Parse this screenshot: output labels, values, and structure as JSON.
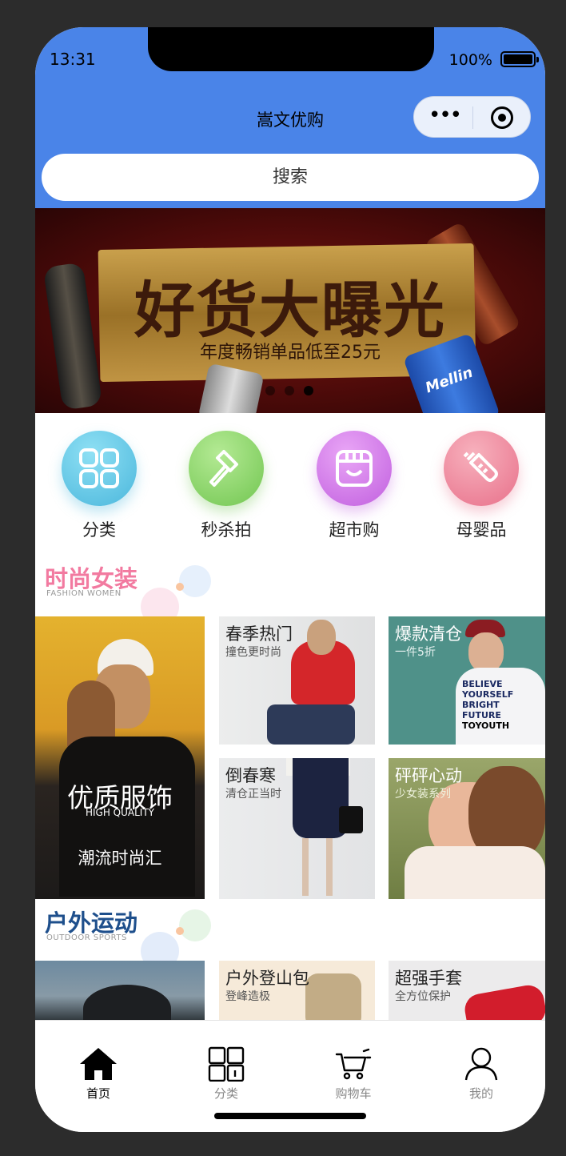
{
  "status_bar": {
    "time": "13:31",
    "battery": "100%"
  },
  "navbar": {
    "title": "嵩文优购",
    "more_icon": "more-dots-icon",
    "close_icon": "target-icon"
  },
  "search": {
    "placeholder": "搜索"
  },
  "banner": {
    "title": "好货大曝光",
    "subtitle": "年度畅销单品低至25元",
    "slide_count": 3,
    "active_slide": 3,
    "bottle_label": "Mellin"
  },
  "categories": [
    {
      "label": "分类",
      "icon": "grid-icon",
      "color": "#5fc3e6"
    },
    {
      "label": "秒杀拍",
      "icon": "hammer-icon",
      "color": "#8fd46e"
    },
    {
      "label": "超市购",
      "icon": "shop-icon",
      "color": "#d37ee8"
    },
    {
      "label": "母婴品",
      "icon": "baby-bottle-icon",
      "color": "#f0889a"
    }
  ],
  "sections": [
    {
      "title": "时尚女装",
      "subtitle": "FASHION WOMEN",
      "title_color": "#f27aa0",
      "tiles": [
        {
          "title": "优质服饰",
          "subtitle": "HIGH QUALITY",
          "slogan": "潮流时尚汇"
        },
        {
          "title": "春季热门",
          "subtitle": "撞色更时尚"
        },
        {
          "title": "爆款清仓",
          "subtitle": "一件5折",
          "image_text": [
            "BELIEVE",
            "YOURSELF",
            "BRIGHT",
            "FUTURE",
            "TOYOUTH"
          ]
        },
        {
          "title": "倒春寒",
          "subtitle": "清仓正当时"
        },
        {
          "title": "砰砰心动",
          "subtitle": "少女装系列"
        }
      ]
    },
    {
      "title": "户外运动",
      "subtitle": "OUTDOOR SPORTS",
      "title_color": "#1e4f8c",
      "tiles": [
        {
          "title": ""
        },
        {
          "title": "户外登山包",
          "subtitle": "登峰造极"
        },
        {
          "title": "超强手套",
          "subtitle": "全方位保护"
        }
      ]
    }
  ],
  "tabbar": [
    {
      "label": "首页",
      "icon": "home-icon",
      "active": true
    },
    {
      "label": "分类",
      "icon": "category-grid-icon",
      "active": false
    },
    {
      "label": "购物车",
      "icon": "cart-icon",
      "active": false
    },
    {
      "label": "我的",
      "icon": "user-icon",
      "active": false
    }
  ]
}
